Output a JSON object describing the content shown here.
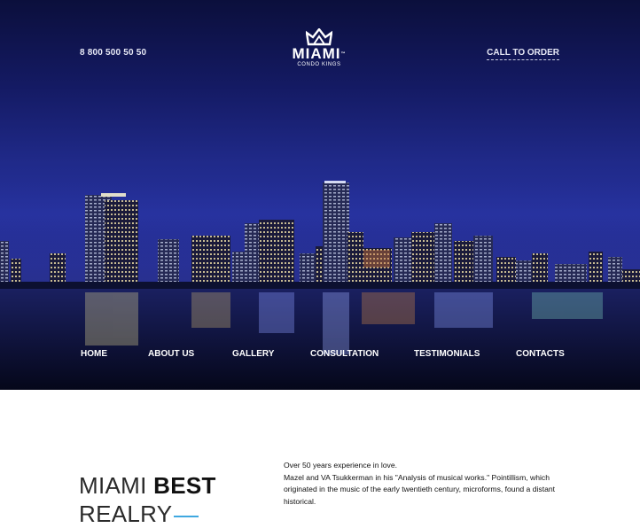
{
  "header": {
    "phone": "8 800 500 50 50",
    "cta_label": "CALL TO ORDER",
    "logo": {
      "title": "MIAMI",
      "trademark": "™",
      "subtitle": "CONDO KINGS",
      "icon": "crown-icon"
    }
  },
  "nav": {
    "items": [
      {
        "label": "HOME"
      },
      {
        "label": "ABOUT US"
      },
      {
        "label": "GALLERY"
      },
      {
        "label": "CONSULTATION"
      },
      {
        "label": "TESTIMONIALS"
      },
      {
        "label": "CONTACTS"
      }
    ]
  },
  "intro": {
    "heading_light": "MIAMI",
    "heading_bold": "BEST",
    "heading_line2": "REALRY",
    "text_line1": "Over 50 years experience in love.",
    "text_line2": "Mazel and VA Tsukkerman in his \"Analysis of musical works.\" Pointillism, which originated in the music of the early twentieth century, microforms, found a distant historical."
  },
  "colors": {
    "accent": "#3fa8e0",
    "hero_top": "#0b0f3c",
    "hero_mid": "#25309a"
  }
}
